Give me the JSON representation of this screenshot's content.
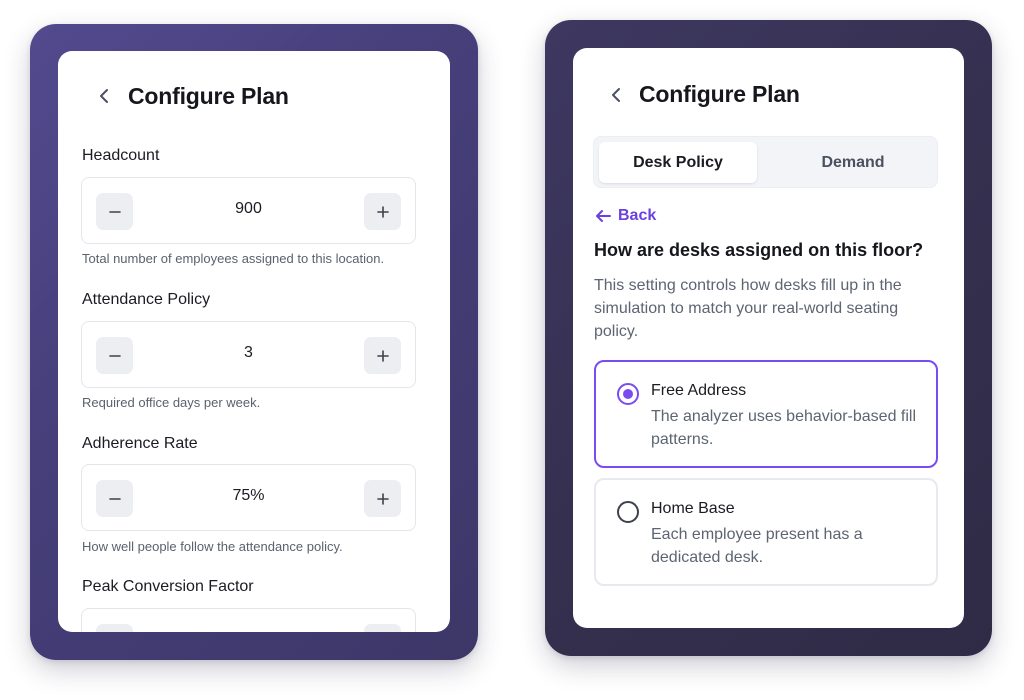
{
  "left": {
    "title": "Configure Plan",
    "fields": [
      {
        "label": "Headcount",
        "value": "900",
        "helper": "Total number of employees assigned to this location."
      },
      {
        "label": "Attendance Policy",
        "value": "3",
        "helper": "Required office days per week."
      },
      {
        "label": "Adherence Rate",
        "value": "75%",
        "helper": "How well people follow the attendance policy."
      },
      {
        "label": "Peak Conversion Factor",
        "value": "",
        "helper": ""
      }
    ]
  },
  "right": {
    "title": "Configure Plan",
    "tabs": [
      {
        "label": "Desk Policy",
        "active": true
      },
      {
        "label": "Demand",
        "active": false
      }
    ],
    "back_label": "Back",
    "question": "How are desks assigned on this floor?",
    "description": "This setting controls how desks fill up in the simulation to match your real-world seating policy.",
    "options": [
      {
        "title": "Free Address",
        "description": "The analyzer uses behavior-based fill patterns.",
        "selected": true
      },
      {
        "title": "Home Base",
        "description": "Each employee present has a dedicated desk.",
        "selected": false
      }
    ]
  },
  "colors": {
    "accent": "#7a4cf0",
    "frame_left": "#4a4283",
    "frame_right": "#35304f"
  },
  "icons": [
    "chevron-left-icon",
    "minus-icon",
    "plus-icon",
    "arrow-left-icon",
    "radio-icon"
  ]
}
